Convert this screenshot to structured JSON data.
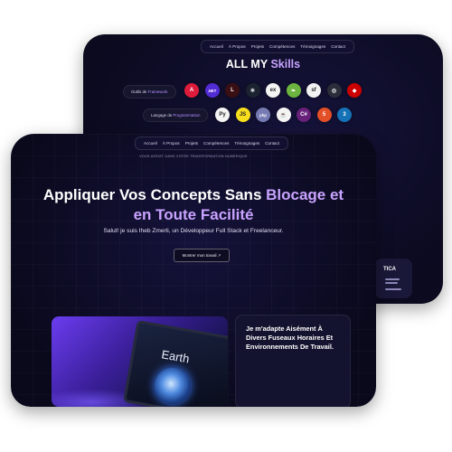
{
  "nav": {
    "items": [
      "Accueil",
      "À Propos",
      "Projets",
      "Compétences",
      "Témoignages",
      "Contact"
    ]
  },
  "skills": {
    "title_main": "ALL MY ",
    "title_accent": "Skills",
    "framework_pill": {
      "main": "Outils de ",
      "accent": "Framework"
    },
    "language_pill": {
      "main": "Langage de ",
      "accent": "Programmation"
    },
    "framework_icons": [
      {
        "name": "angular-icon",
        "glyph": "A",
        "color": "#dd1b3b"
      },
      {
        "name": "dotnet-icon",
        "glyph": ".NET",
        "color": "#512bd4"
      },
      {
        "name": "laravel-icon",
        "glyph": "L",
        "color": "#3a0f14"
      },
      {
        "name": "react-icon",
        "glyph": "⚛",
        "color": "#1b2230"
      },
      {
        "name": "express-icon",
        "glyph": "ex",
        "color": "#f4f4f4"
      },
      {
        "name": "spring-icon",
        "glyph": "❧",
        "color": "#6db33f"
      },
      {
        "name": "symfony-icon",
        "glyph": "sf",
        "color": "#f2f2f2"
      },
      {
        "name": "electron-icon",
        "glyph": "◎",
        "color": "#2b2e3a"
      },
      {
        "name": "rails-icon",
        "glyph": "◆",
        "color": "#cc0000"
      }
    ],
    "language_icons": [
      {
        "name": "python-icon",
        "glyph": "Py",
        "color": "#f4f4f4"
      },
      {
        "name": "javascript-icon",
        "glyph": "JS",
        "color": "#f7df1e"
      },
      {
        "name": "php-icon",
        "glyph": "php",
        "color": "#777bb4"
      },
      {
        "name": "java-icon",
        "glyph": "☕",
        "color": "#f4f4f4"
      },
      {
        "name": "csharp-icon",
        "glyph": "C#",
        "color": "#68217a"
      },
      {
        "name": "html5-icon",
        "glyph": "5",
        "color": "#e34f26"
      },
      {
        "name": "css3-icon",
        "glyph": "3",
        "color": "#1572b6"
      }
    ]
  },
  "side_card": {
    "title": "TICA"
  },
  "hero": {
    "eyebrow": "VOUS ASSIST DANS VOTRE TRANSFORMATION NUMÉRIQUE",
    "title_line1_main": "Appliquer Vos Concepts Sans ",
    "title_line1_accent": "Blocage et",
    "title_line2_accent": "en Toute Facilité",
    "subtitle": "Salut! je suis Iheb Zmerli, un Développeur Full Stack et Freelanceur.",
    "cta": "Montrer mon travail ↗"
  },
  "laptop": {
    "screen_text": "Earth"
  },
  "info_card": {
    "text": "Je m'adapte Aisément À Divers Fuseaux Horaires Et Environnements De Travail."
  },
  "colors": {
    "accent": "#c9a3ff",
    "background": "#0b0a1f"
  }
}
